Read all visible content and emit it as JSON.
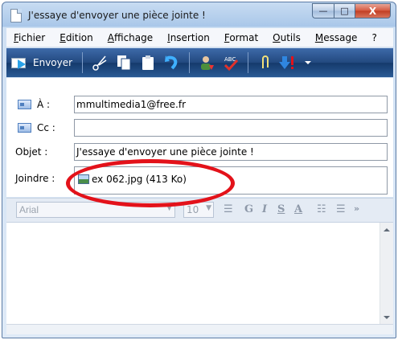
{
  "window": {
    "title": "J'essaye d'envoyer une pièce jointe !",
    "min_glyph": "—",
    "max_glyph": "□",
    "close_glyph": "X"
  },
  "menu": {
    "items": [
      "Fichier",
      "Edition",
      "Affichage",
      "Insertion",
      "Format",
      "Outils",
      "Message",
      "?"
    ]
  },
  "toolbar": {
    "send_label": "Envoyer",
    "icons": [
      "scissors-icon",
      "copy-icon",
      "paste-icon",
      "undo-icon",
      "contacts-icon",
      "spellcheck-icon",
      "attach-icon",
      "priority-icon"
    ]
  },
  "fields": {
    "to_label": "À :",
    "to_value": "mmultimedia1@free.fr",
    "cc_label": "Cc :",
    "cc_value": "",
    "subject_label": "Objet :",
    "subject_value": "J'essaye d'envoyer une pièce jointe !",
    "attach_label": "Joindre :",
    "attachment": "ex 062.jpg (413 Ko)"
  },
  "format": {
    "font": "Arial",
    "size": "10",
    "bold": "G",
    "italic": "I",
    "underline": "S",
    "color": "A"
  },
  "colors": {
    "highlight": "#e3121a",
    "toolbar": "#22497f"
  }
}
